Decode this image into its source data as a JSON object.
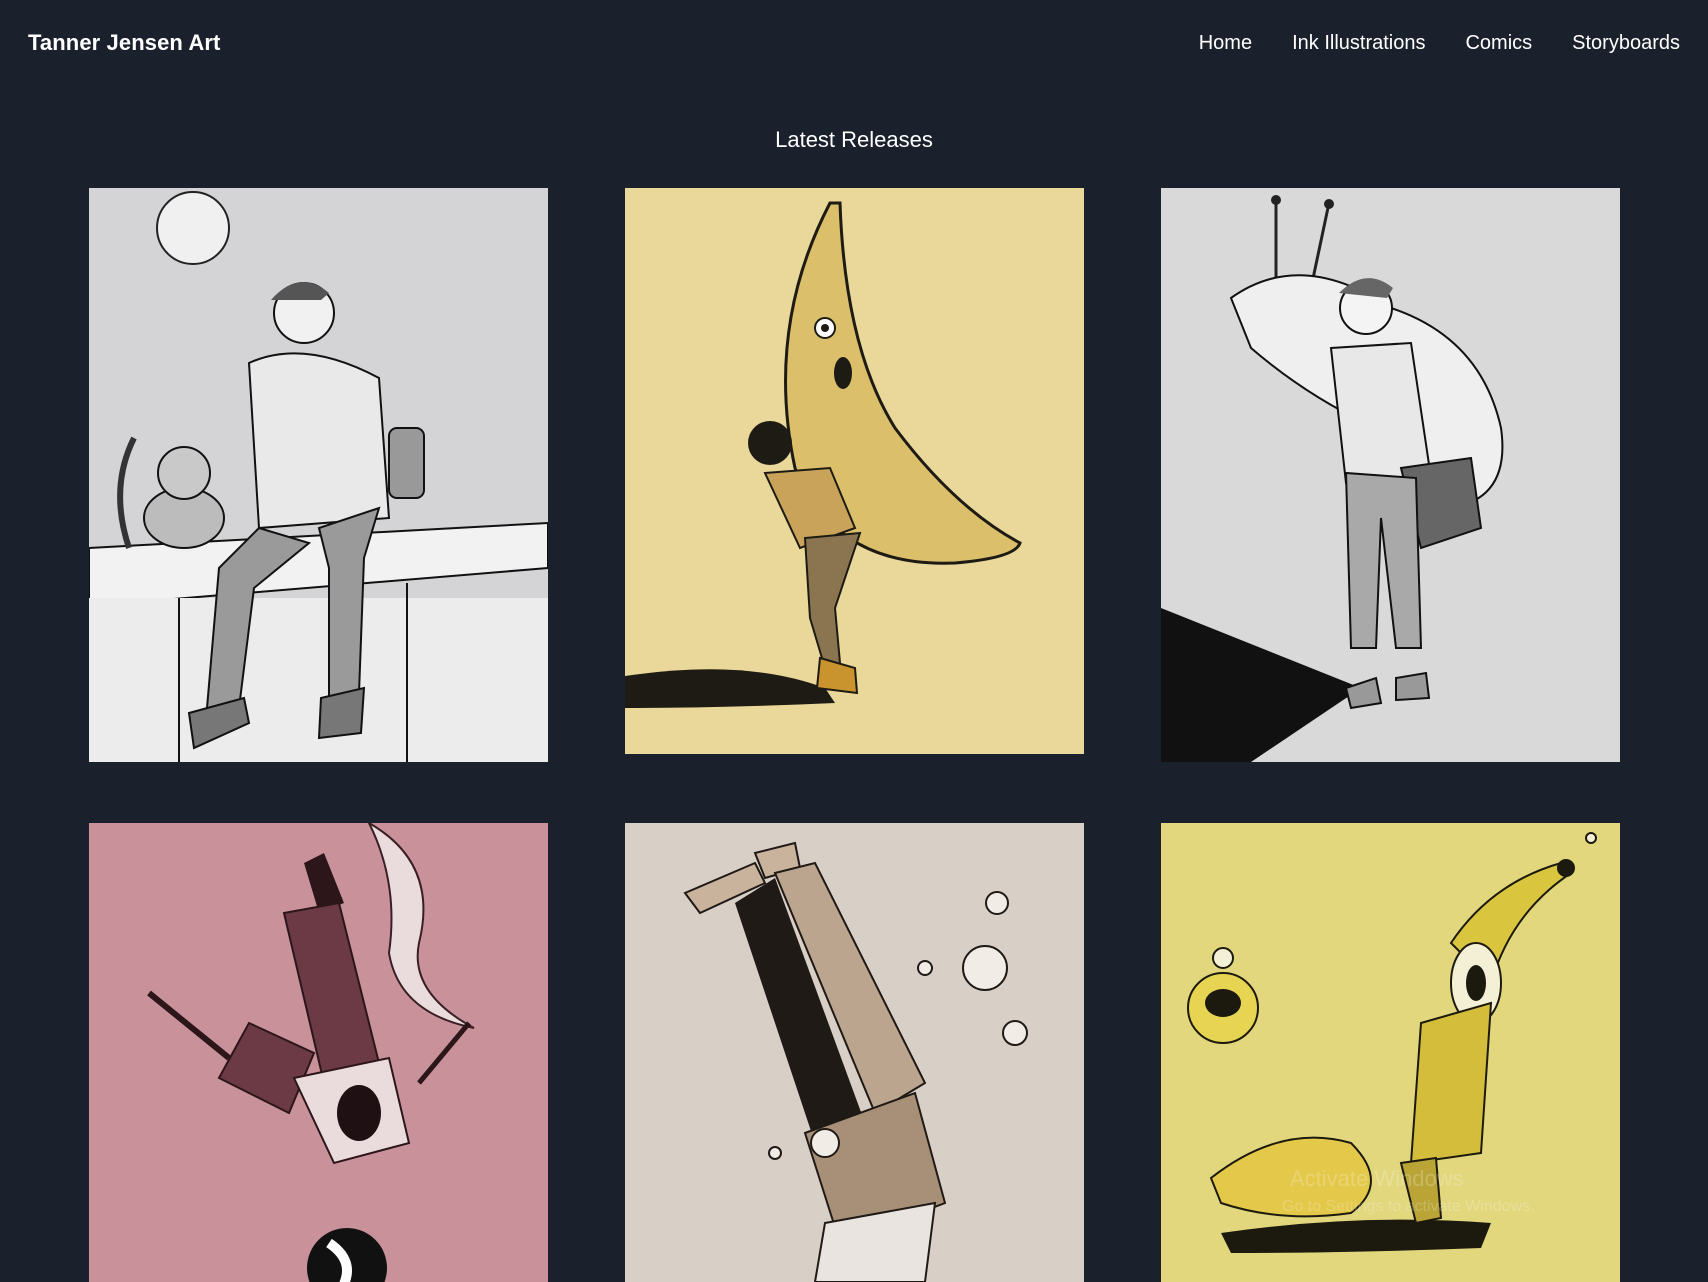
{
  "header": {
    "brand": "Tanner Jensen Art",
    "nav": [
      "Home",
      "Ink Illustrations",
      "Comics",
      "Storyboards"
    ]
  },
  "main": {
    "section_title": "Latest Releases"
  },
  "watermark": {
    "title": "Activate Windows",
    "subtitle": "Go to Settings to activate Windows."
  },
  "colors": {
    "background": "#1b202d",
    "text": "#ffffff",
    "card_gray": "#d4d4d6",
    "card_yellow": "#ead79a",
    "card_pink": "#c9929b",
    "card_beige": "#d8cfc6",
    "card_lemon": "#e2d77d"
  }
}
